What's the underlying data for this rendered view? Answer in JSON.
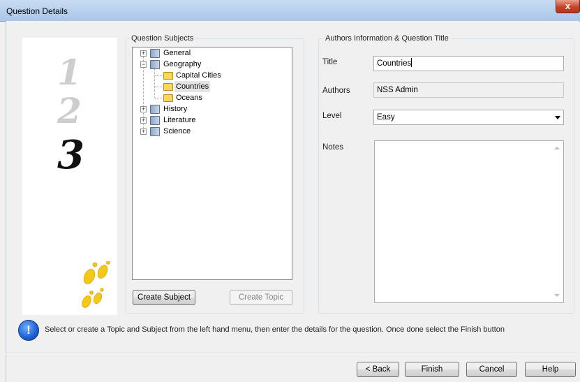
{
  "window": {
    "title": "Question Details",
    "close_label": "x"
  },
  "wizard_art": {
    "steps": [
      "1",
      "2",
      "3"
    ],
    "active_step": "3"
  },
  "subjects": {
    "group_label": "Question Subjects",
    "tree": [
      {
        "label": "General",
        "type": "subject",
        "expanded": false
      },
      {
        "label": "Geography",
        "type": "subject",
        "expanded": true
      },
      {
        "label": "Capital Cities",
        "type": "topic"
      },
      {
        "label": "Countries",
        "type": "topic",
        "selected": true
      },
      {
        "label": "Oceans",
        "type": "topic"
      },
      {
        "label": "History",
        "type": "subject",
        "expanded": false
      },
      {
        "label": "Literature",
        "type": "subject",
        "expanded": false
      },
      {
        "label": "Science",
        "type": "subject",
        "expanded": false
      }
    ],
    "create_subject_label": "Create Subject",
    "create_topic_label": "Create Topic"
  },
  "details": {
    "group_label": "Authors Information & Question Title",
    "title_label": "Title",
    "title_value": "Countries",
    "authors_label": "Authors",
    "authors_value": "NSS Admin",
    "level_label": "Level",
    "level_value": "Easy",
    "notes_label": "Notes",
    "notes_value": ""
  },
  "info": {
    "message": "Select or create a Topic and Subject from the left hand menu, then enter the details for the question. Once done select the Finish button"
  },
  "footer": {
    "back_label": "< Back",
    "finish_label": "Finish",
    "cancel_label": "Cancel",
    "help_label": "Help"
  },
  "colors": {
    "accent": "#1d5fd1",
    "folder": "#f6d65c",
    "footprints": "#f2c81a"
  }
}
